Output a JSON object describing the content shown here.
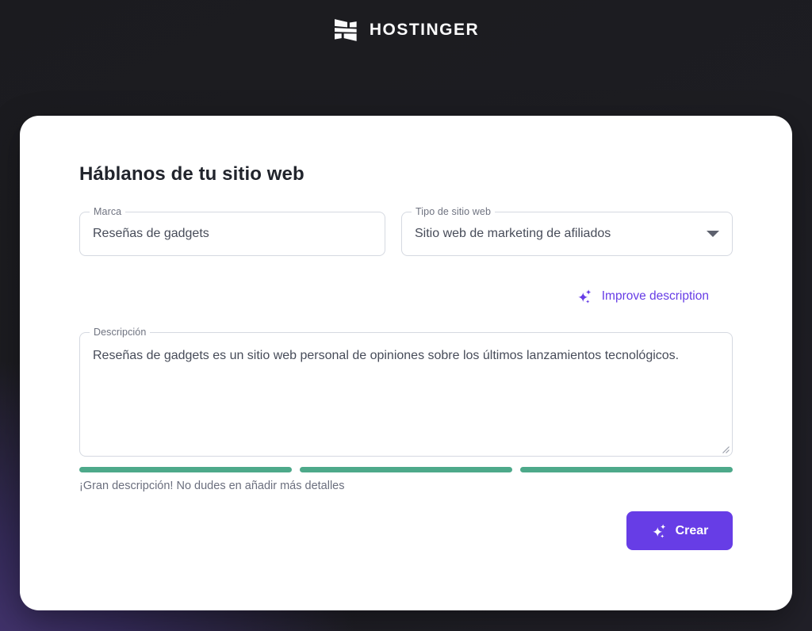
{
  "header": {
    "brand": "HOSTINGER"
  },
  "form": {
    "title": "Háblanos de tu sitio web",
    "brand_field": {
      "label": "Marca",
      "value": "Reseñas de gadgets"
    },
    "type_field": {
      "label": "Tipo de sitio web",
      "value": "Sitio web de marketing de afiliados"
    },
    "improve_link_label": "Improve description",
    "description_field": {
      "label": "Descripción",
      "value": "Reseñas de gadgets es un sitio web personal de opiniones sobre los últimos lanzamientos tecnológicos."
    },
    "quality": {
      "segments": [
        100,
        100,
        100
      ],
      "message": "¡Gran descripción! No dudes en añadir más detalles"
    },
    "create_button_label": "Crear"
  },
  "icons": {
    "logo": "hostinger-h-icon",
    "sparkles": "sparkles-icon",
    "caret": "chevron-down-icon"
  },
  "colors": {
    "accent": "#673de6",
    "success": "#4da98a",
    "header_background": "#1b1b1f"
  }
}
